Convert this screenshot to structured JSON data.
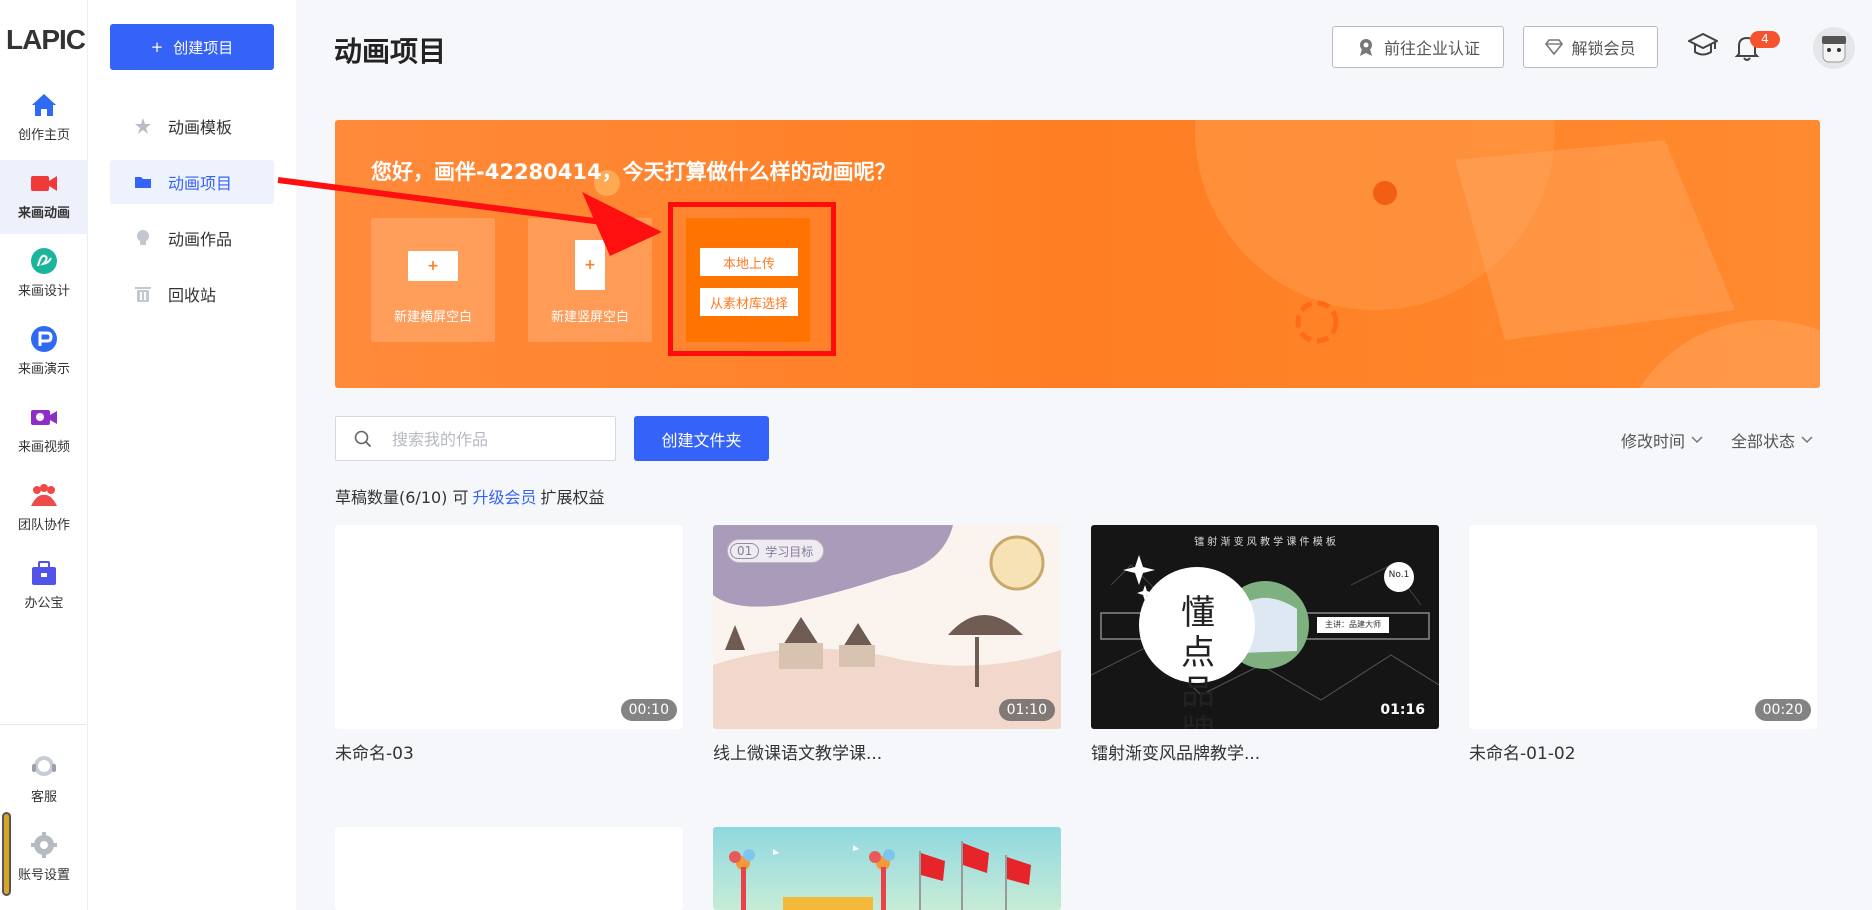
{
  "app": {
    "logo": "LAPIC"
  },
  "rail": {
    "items": [
      {
        "label": "创作主页",
        "icon": "home-icon",
        "color": "#2f6af5"
      },
      {
        "label": "来画动画",
        "icon": "video-camera-icon",
        "color": "#f03a3a"
      },
      {
        "label": "来画设计",
        "icon": "design-icon",
        "color": "#1bb59c"
      },
      {
        "label": "来画演示",
        "icon": "presentation-icon",
        "color": "#2f6af5"
      },
      {
        "label": "来画视频",
        "icon": "video-icon",
        "color": "#8d2ec9"
      },
      {
        "label": "团队协作",
        "icon": "team-icon",
        "color": "#ef4a4a"
      },
      {
        "label": "办公宝",
        "icon": "briefcase-icon",
        "color": "#5254e8"
      }
    ],
    "bottom": [
      {
        "label": "客服",
        "icon": "headset-icon"
      },
      {
        "label": "账号设置",
        "icon": "gear-icon"
      }
    ]
  },
  "sidebar": {
    "create_label": "创建项目",
    "items": [
      {
        "label": "动画模板",
        "icon": "star-icon"
      },
      {
        "label": "动画项目",
        "icon": "folder-icon"
      },
      {
        "label": "动画作品",
        "icon": "bulb-icon"
      },
      {
        "label": "回收站",
        "icon": "trash-icon"
      }
    ]
  },
  "header": {
    "title": "动画项目",
    "enterprise_label": "前往企业认证",
    "vip_label": "解锁会员",
    "notification_count": "4"
  },
  "banner": {
    "greeting": "您好，画伴-42280414，今天打算做什么样的动画呢？",
    "tile_landscape": "新建横屏空白",
    "tile_portrait": "新建竖屏空白",
    "upload_local": "本地上传",
    "upload_library": "从素材库选择",
    "plus": "+"
  },
  "toolbar": {
    "search_placeholder": "搜索我的作品",
    "create_folder": "创建文件夹",
    "sort_label": "修改时间",
    "status_label": "全部状态"
  },
  "quota": {
    "prefix": "草稿数量(6/10) 可",
    "link": "升级会员",
    "suffix": "扩展权益"
  },
  "projects": [
    {
      "title": "未命名-03",
      "duration": "00:10"
    },
    {
      "title": "线上微课语文教学课...",
      "duration": "01:10",
      "thumb_tag_num": "01",
      "thumb_tag": "学习目标"
    },
    {
      "title": "镭射渐变风品牌教学...",
      "duration": "01:16",
      "thumb_banner": "镭 射 渐 变 风 教 学 课 件 模 板",
      "thumb_word": "懂点品牌",
      "thumb_badge": "No.1",
      "thumb_speaker": "主讲：品建大师"
    },
    {
      "title": "未命名-01-02",
      "duration": "00:20"
    },
    {
      "title": "",
      "duration": ""
    },
    {
      "title": "",
      "duration": ""
    }
  ]
}
